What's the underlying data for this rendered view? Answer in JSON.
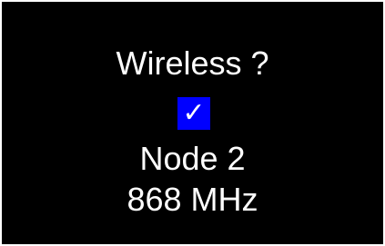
{
  "screen": {
    "title": "Wireless ?",
    "checkbox": {
      "checked": true,
      "glyph": "✓",
      "color": "#0000ff"
    },
    "node_label": "Node 2",
    "frequency": "868 MHz"
  }
}
